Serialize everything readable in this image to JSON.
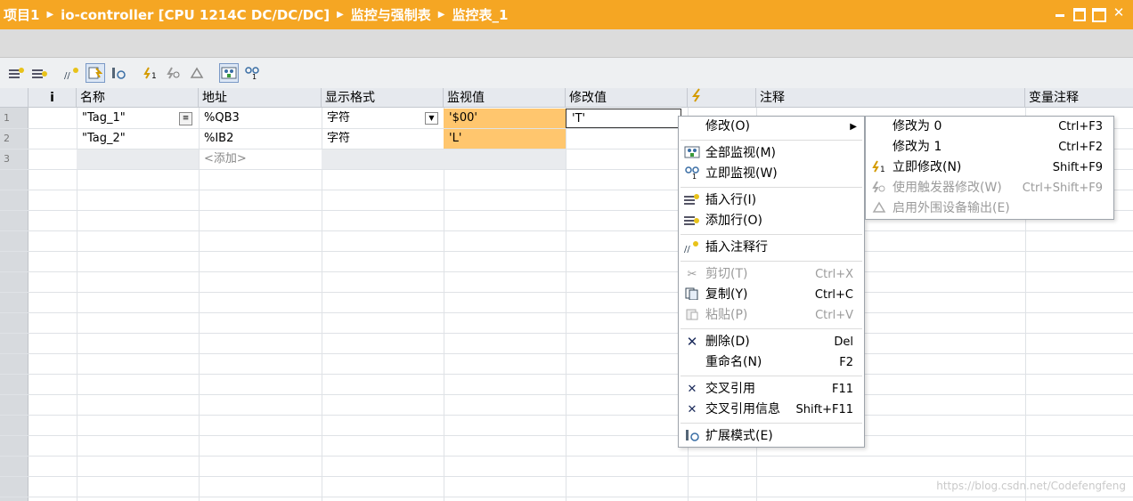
{
  "title": {
    "crumbs": [
      "项目1",
      "io-controller [CPU 1214C DC/DC/DC]",
      "监控与强制表",
      "监控表_1"
    ]
  },
  "table": {
    "headers": {
      "info": "i",
      "name": "名称",
      "address": "地址",
      "format": "显示格式",
      "monitor": "监视值",
      "modify": "修改值",
      "comment": "注释",
      "var_comment": "变量注释"
    },
    "rows": [
      {
        "num": "1",
        "name": "\"Tag_1\"",
        "address": "%QB3",
        "format": "字符",
        "monitor": "'$00'",
        "modify": "'T'"
      },
      {
        "num": "2",
        "name": "\"Tag_2\"",
        "address": "%IB2",
        "format": "字符",
        "monitor": "'L'",
        "modify": ""
      },
      {
        "num": "3",
        "name": "",
        "address": "<添加>",
        "format": "",
        "monitor": "",
        "modify": ""
      }
    ]
  },
  "context_menu": {
    "modify": "修改(O)",
    "monitor_all": "全部监视(M)",
    "monitor_now": "立即监视(W)",
    "insert_row": "插入行(I)",
    "add_row": "添加行(O)",
    "insert_comment_row": "插入注释行",
    "cut": "剪切(T)",
    "cut_sc": "Ctrl+X",
    "copy": "复制(Y)",
    "copy_sc": "Ctrl+C",
    "paste": "粘贴(P)",
    "paste_sc": "Ctrl+V",
    "delete": "删除(D)",
    "delete_sc": "Del",
    "rename": "重命名(N)",
    "rename_sc": "F2",
    "cross_ref": "交叉引用",
    "cross_ref_sc": "F11",
    "cross_ref_info": "交叉引用信息",
    "cross_ref_info_sc": "Shift+F11",
    "extended_mode": "扩展模式(E)"
  },
  "submenu": {
    "modify_to_0": "修改为 0",
    "modify_to_0_sc": "Ctrl+F3",
    "modify_to_1": "修改为 1",
    "modify_to_1_sc": "Ctrl+F2",
    "modify_now": "立即修改(N)",
    "modify_now_sc": "Shift+F9",
    "modify_trigger": "使用触发器修改(W)",
    "modify_trigger_sc": "Ctrl+Shift+F9",
    "enable_periph": "启用外围设备输出(E)"
  },
  "watermark": "https://blog.csdn.net/Codefengfeng",
  "colors": {
    "accent": "#f5a623",
    "monitor_bg": "#ffc66e"
  }
}
